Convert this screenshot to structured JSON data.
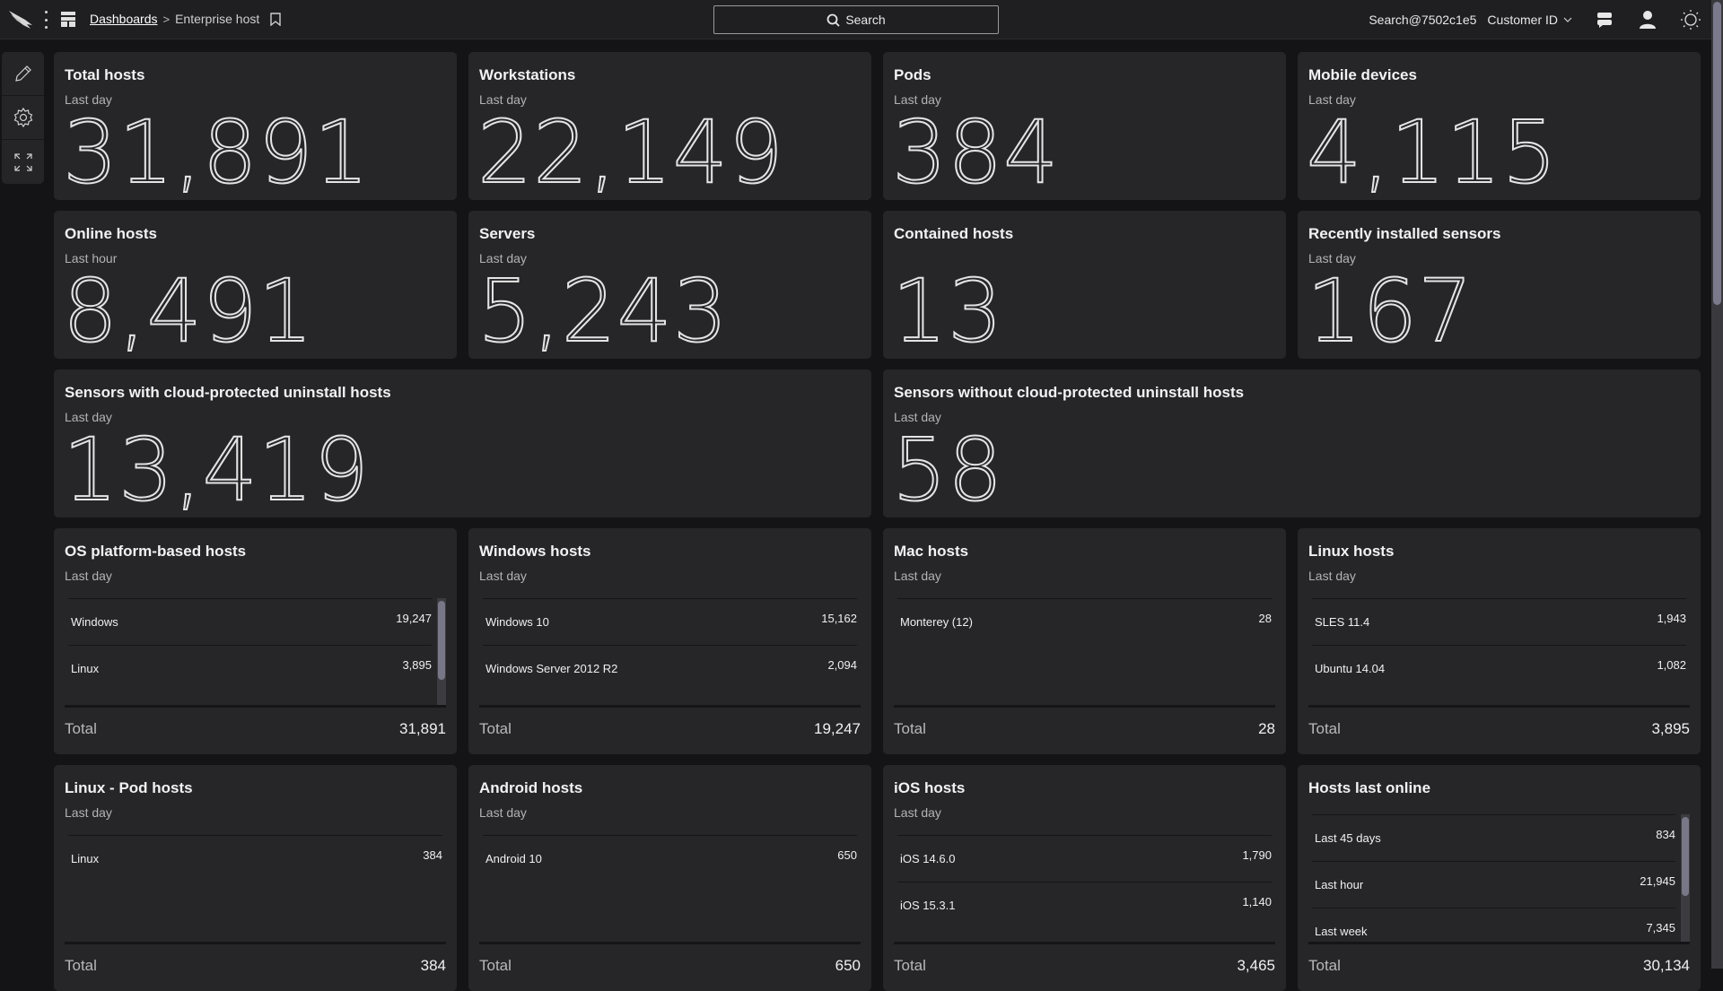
{
  "topbar": {
    "breadcrumb": {
      "root": "Dashboards",
      "separator": ">",
      "current": "Enterprise host"
    },
    "search_label": "Search",
    "user": "Search@7502c1e5",
    "customer_dropdown": "Customer ID"
  },
  "side_tools": [
    "edit",
    "settings",
    "fullscreen"
  ],
  "stat_cards": [
    {
      "title": "Total hosts",
      "period": "Last day",
      "value": "31,891"
    },
    {
      "title": "Workstations",
      "period": "Last day",
      "value": "22,149"
    },
    {
      "title": "Pods",
      "period": "Last day",
      "value": "384"
    },
    {
      "title": "Mobile devices",
      "period": "Last day",
      "value": "4,115"
    },
    {
      "title": "Online hosts",
      "period": "Last hour",
      "value": "8,491"
    },
    {
      "title": "Servers",
      "period": "Last day",
      "value": "5,243"
    },
    {
      "title": "Contained hosts",
      "period": "",
      "value": "13"
    },
    {
      "title": "Recently installed sensors",
      "period": "Last day",
      "value": "167"
    },
    {
      "title": "Sensors with cloud-protected uninstall hosts",
      "period": "Last day",
      "value": "13,419"
    },
    {
      "title": "Sensors without cloud-protected uninstall hosts",
      "period": "Last day",
      "value": "58"
    }
  ],
  "list_cards": [
    {
      "title": "OS platform-based hosts",
      "period": "Last day",
      "rows": [
        {
          "label": "Windows",
          "value": "19,247"
        },
        {
          "label": "Linux",
          "value": "3,895"
        }
      ],
      "total_label": "Total",
      "total": "31,891",
      "scroll": true
    },
    {
      "title": "Windows hosts",
      "period": "Last day",
      "rows": [
        {
          "label": "Windows 10",
          "value": "15,162"
        },
        {
          "label": "Windows Server 2012 R2",
          "value": "2,094"
        }
      ],
      "total_label": "Total",
      "total": "19,247",
      "scroll": false
    },
    {
      "title": "Mac hosts",
      "period": "Last day",
      "rows": [
        {
          "label": "Monterey (12)",
          "value": "28"
        }
      ],
      "total_label": "Total",
      "total": "28",
      "scroll": false
    },
    {
      "title": "Linux hosts",
      "period": "Last day",
      "rows": [
        {
          "label": "SLES 11.4",
          "value": "1,943"
        },
        {
          "label": "Ubuntu 14.04",
          "value": "1,082"
        }
      ],
      "total_label": "Total",
      "total": "3,895",
      "scroll": false
    },
    {
      "title": "Linux - Pod hosts",
      "period": "Last day",
      "rows": [
        {
          "label": "Linux",
          "value": "384"
        }
      ],
      "total_label": "Total",
      "total": "384",
      "scroll": false
    },
    {
      "title": "Android hosts",
      "period": "Last day",
      "rows": [
        {
          "label": "Android 10",
          "value": "650"
        }
      ],
      "total_label": "Total",
      "total": "650",
      "scroll": false
    },
    {
      "title": "iOS hosts",
      "period": "Last day",
      "rows": [
        {
          "label": "iOS 14.6.0",
          "value": "1,790"
        },
        {
          "label": "iOS 15.3.1",
          "value": "1,140"
        }
      ],
      "total_label": "Total",
      "total": "3,465",
      "scroll": false
    },
    {
      "title": "Hosts last online",
      "period": "",
      "rows": [
        {
          "label": "Last 45 days",
          "value": "834"
        },
        {
          "label": "Last hour",
          "value": "21,945"
        },
        {
          "label": "Last week",
          "value": "7,345"
        }
      ],
      "total_label": "Total",
      "total": "30,134",
      "scroll": true
    }
  ]
}
